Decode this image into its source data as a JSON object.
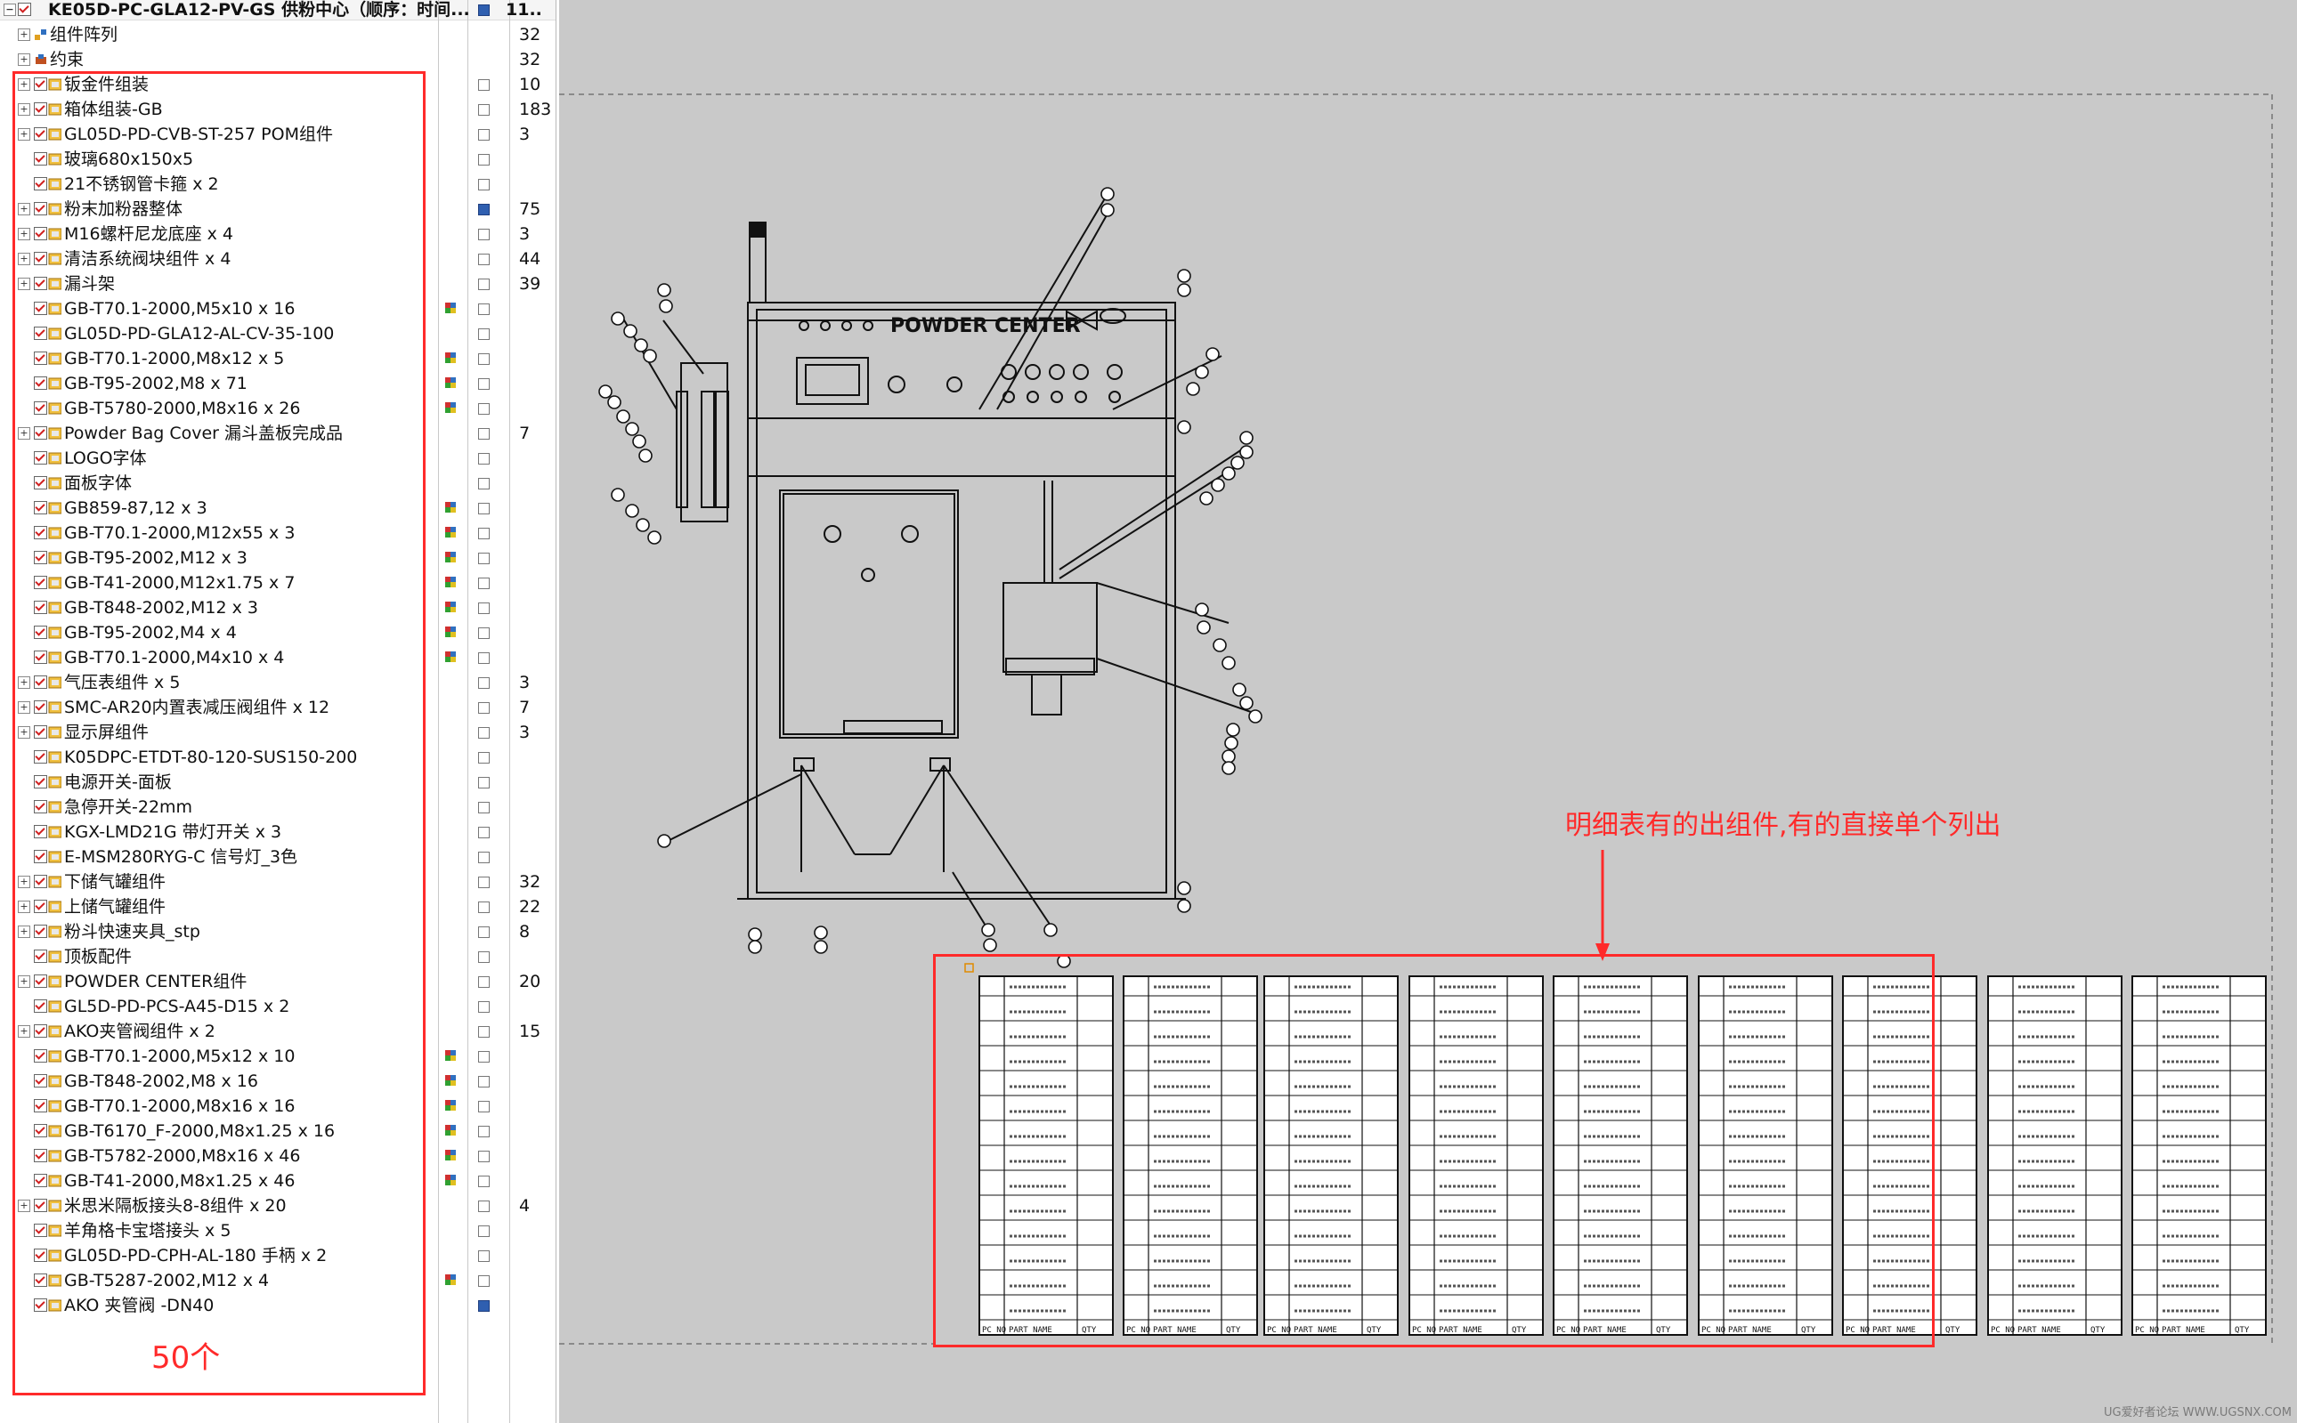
{
  "tree": {
    "title": "KE05D-PC-GLA12-PV-GS 供粉中心（顺序：时间...",
    "title_count": "11..",
    "items": [
      {
        "label": "组件阵列",
        "count": "32",
        "expand": true,
        "type": "array"
      },
      {
        "label": "约束",
        "count": "32",
        "expand": true,
        "type": "constraint"
      },
      {
        "label": "钣金件组装",
        "count": "10",
        "expand": true
      },
      {
        "label": "箱体组装-GB",
        "count": "183",
        "expand": true
      },
      {
        "label": "GL05D-PD-CVB-ST-257 POM组件",
        "count": "3",
        "expand": true
      },
      {
        "label": "玻璃680x150x5",
        "count": "",
        "expand": false
      },
      {
        "label": "21不锈钢管卡箍 x 2",
        "count": "",
        "expand": false
      },
      {
        "label": "粉末加粉器整体",
        "count": "75",
        "expand": true,
        "saved": true
      },
      {
        "label": "M16螺杆尼龙底座 x 4",
        "count": "3",
        "expand": true
      },
      {
        "label": "清洁系统阀块组件 x 4",
        "count": "44",
        "expand": true
      },
      {
        "label": "漏斗架",
        "count": "39",
        "expand": true
      },
      {
        "label": "GB-T70.1-2000,M5x10 x 16",
        "count": "",
        "expand": false,
        "ref": true
      },
      {
        "label": "GL05D-PD-GLA12-AL-CV-35-100",
        "count": "",
        "expand": false
      },
      {
        "label": "GB-T70.1-2000,M8x12 x 5",
        "count": "",
        "expand": false,
        "ref": true
      },
      {
        "label": "GB-T95-2002,M8 x 71",
        "count": "",
        "expand": false,
        "ref": true
      },
      {
        "label": "GB-T5780-2000,M8x16 x 26",
        "count": "",
        "expand": false,
        "ref": true
      },
      {
        "label": "Powder Bag Cover 漏斗盖板完成品",
        "count": "7",
        "expand": true
      },
      {
        "label": "LOGO字体",
        "count": "",
        "expand": false
      },
      {
        "label": "面板字体",
        "count": "",
        "expand": false
      },
      {
        "label": "GB859-87,12 x 3",
        "count": "",
        "expand": false,
        "ref": true
      },
      {
        "label": "GB-T70.1-2000,M12x55 x 3",
        "count": "",
        "expand": false,
        "ref": true
      },
      {
        "label": "GB-T95-2002,M12 x 3",
        "count": "",
        "expand": false,
        "ref": true
      },
      {
        "label": "GB-T41-2000,M12x1.75 x 7",
        "count": "",
        "expand": false,
        "ref": true
      },
      {
        "label": "GB-T848-2002,M12 x 3",
        "count": "",
        "expand": false,
        "ref": true
      },
      {
        "label": "GB-T95-2002,M4 x 4",
        "count": "",
        "expand": false,
        "ref": true
      },
      {
        "label": "GB-T70.1-2000,M4x10 x 4",
        "count": "",
        "expand": false,
        "ref": true
      },
      {
        "label": "气压表组件 x 5",
        "count": "3",
        "expand": true
      },
      {
        "label": "SMC-AR20内置表减压阀组件 x 12",
        "count": "7",
        "expand": true
      },
      {
        "label": "显示屏组件",
        "count": "3",
        "expand": true
      },
      {
        "label": "K05DPC-ETDT-80-120-SUS150-200",
        "count": "",
        "expand": false
      },
      {
        "label": "电源开关-面板",
        "count": "",
        "expand": false
      },
      {
        "label": "急停开关-22mm",
        "count": "",
        "expand": false
      },
      {
        "label": "KGX-LMD21G 带灯开关 x 3",
        "count": "",
        "expand": false
      },
      {
        "label": "E-MSM280RYG-C 信号灯_3色",
        "count": "",
        "expand": false
      },
      {
        "label": "下储气罐组件",
        "count": "32",
        "expand": true
      },
      {
        "label": "上储气罐组件",
        "count": "22",
        "expand": true
      },
      {
        "label": "粉斗快速夹具_stp",
        "count": "8",
        "expand": true
      },
      {
        "label": "顶板配件",
        "count": "",
        "expand": false
      },
      {
        "label": "POWDER CENTER组件",
        "count": "20",
        "expand": true
      },
      {
        "label": "GL5D-PD-PCS-A45-D15 x 2",
        "count": "",
        "expand": false
      },
      {
        "label": "AKO夹管阀组件 x 2",
        "count": "15",
        "expand": true
      },
      {
        "label": "GB-T70.1-2000,M5x12 x 10",
        "count": "",
        "expand": false,
        "ref": true
      },
      {
        "label": "GB-T848-2002,M8 x 16",
        "count": "",
        "expand": false,
        "ref": true
      },
      {
        "label": "GB-T70.1-2000,M8x16 x 16",
        "count": "",
        "expand": false,
        "ref": true
      },
      {
        "label": "GB-T6170_F-2000,M8x1.25 x 16",
        "count": "",
        "expand": false,
        "ref": true
      },
      {
        "label": "GB-T5782-2000,M8x16 x 46",
        "count": "",
        "expand": false,
        "ref": true
      },
      {
        "label": "GB-T41-2000,M8x1.25 x 46",
        "count": "",
        "expand": false,
        "ref": true
      },
      {
        "label": "米思米隔板接头8-8组件 x 20",
        "count": "4",
        "expand": true
      },
      {
        "label": "羊角格卡宝塔接头 x 5",
        "count": "",
        "expand": false
      },
      {
        "label": "GL05D-PD-CPH-AL-180 手柄 x 2",
        "count": "",
        "expand": false
      },
      {
        "label": "GB-T5287-2002,M12 x 4",
        "count": "",
        "expand": false,
        "ref": true
      },
      {
        "label": "AKO 夹管阀 -DN40",
        "count": "",
        "expand": false,
        "saved": true
      }
    ],
    "annotation_count": "50个"
  },
  "drawing": {
    "panel_title": "POWDER CENTER",
    "annotation": "明细表有的出组件,有的直接单个列出",
    "bom_header": {
      "pc_no": "PC NO",
      "part_name": "PART NAME",
      "qty": "QTY"
    }
  },
  "watermark": "UG爱好者论坛 WWW.UGSNX.COM",
  "colors": {
    "annotation_red": "#ff2a2a",
    "canvas_gray": "#c9c9c9",
    "check_red": "#d02020"
  }
}
